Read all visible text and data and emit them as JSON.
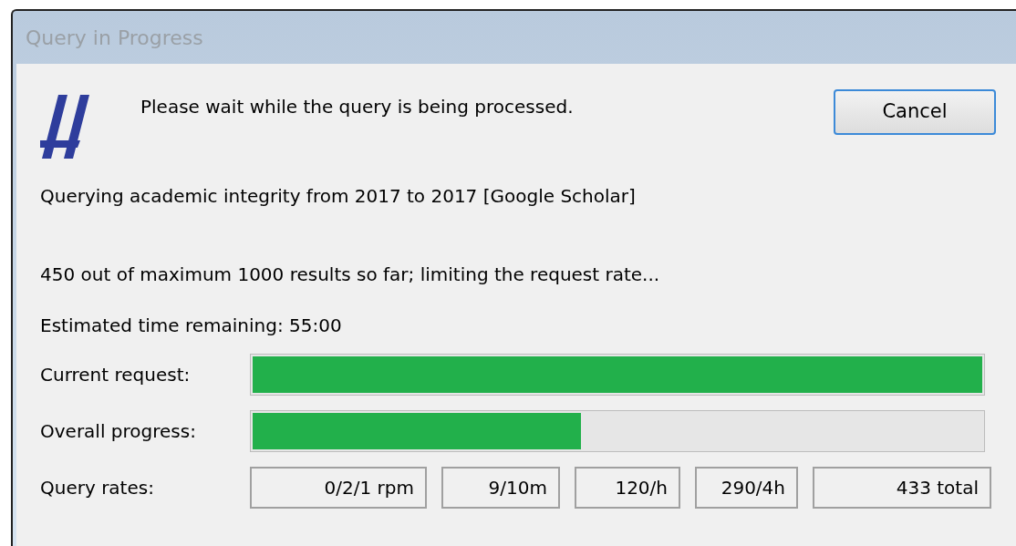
{
  "window": {
    "title": "Query in Progress"
  },
  "message": "Please wait while the query is being processed.",
  "cancel_button": "Cancel",
  "query_line": "Querying academic integrity from 2017 to 2017 [Google Scholar]",
  "status_line": "450 out of maximum 1000 results so far; limiting the request rate...",
  "eta_line": "Estimated time remaining: 55:00",
  "progress": [
    {
      "label": "Current request:",
      "level": 1.0
    },
    {
      "label": "Overall progress:",
      "level": 0.45
    }
  ],
  "rates": {
    "label": "Query rates:",
    "values": [
      "0/2/1 rpm",
      "9/10m",
      "120/h",
      "290/4h",
      "433 total"
    ]
  }
}
